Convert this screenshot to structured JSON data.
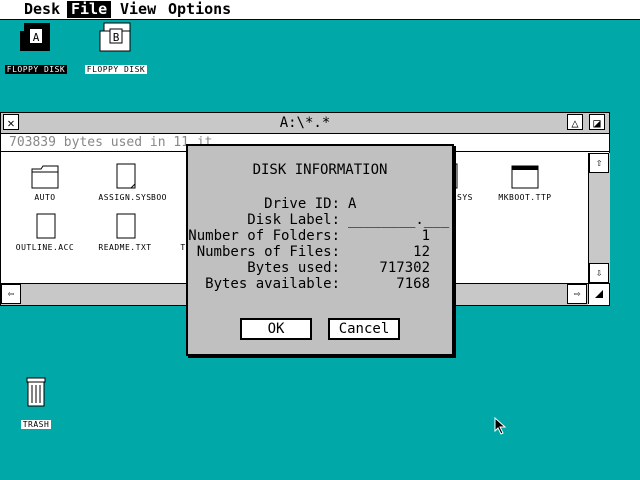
{
  "menubar": {
    "items": [
      {
        "label": "Desk"
      },
      {
        "label": "File"
      },
      {
        "label": "View"
      },
      {
        "label": "Options"
      }
    ]
  },
  "desktop": {
    "floppy_a": {
      "label": "FLOPPY DISK",
      "letter": "A"
    },
    "floppy_b": {
      "label": "FLOPPY DISK",
      "letter": "B"
    },
    "trash": {
      "label": "TRASH"
    }
  },
  "window": {
    "title": "A:\\*.*",
    "info": "703839 bytes used in 11 it",
    "files": [
      {
        "name": "AUTO",
        "type": "folder"
      },
      {
        "name": "ASSIGN.SYS",
        "type": "file"
      },
      {
        "name": "BOO",
        "type": "file"
      },
      {
        "name": "SYS",
        "type": "file"
      },
      {
        "name": "MKBOOT.TTP",
        "type": "program"
      },
      {
        "name": "OUTLINE.ACC",
        "type": "file"
      },
      {
        "name": "README.TXT",
        "type": "file"
      },
      {
        "name": "T",
        "type": "file"
      }
    ]
  },
  "dialog": {
    "title": "DISK INFORMATION",
    "drive_id_label": "Drive ID:",
    "drive_id": "A",
    "disk_label_label": "Disk Label:",
    "disk_label": "________.___",
    "folders_label": "Number of Folders:",
    "folders": "1",
    "files_label": "Numbers of Files:",
    "files": "12",
    "used_label": "Bytes used:",
    "used": "717302",
    "avail_label": "Bytes available:",
    "avail": "7168",
    "ok": "OK",
    "cancel": "Cancel"
  },
  "colors": {
    "desktop": "#00a8a8",
    "window": "#ffffff",
    "dialog": "#c0c0c0",
    "chrome": "#c8c8c8"
  }
}
